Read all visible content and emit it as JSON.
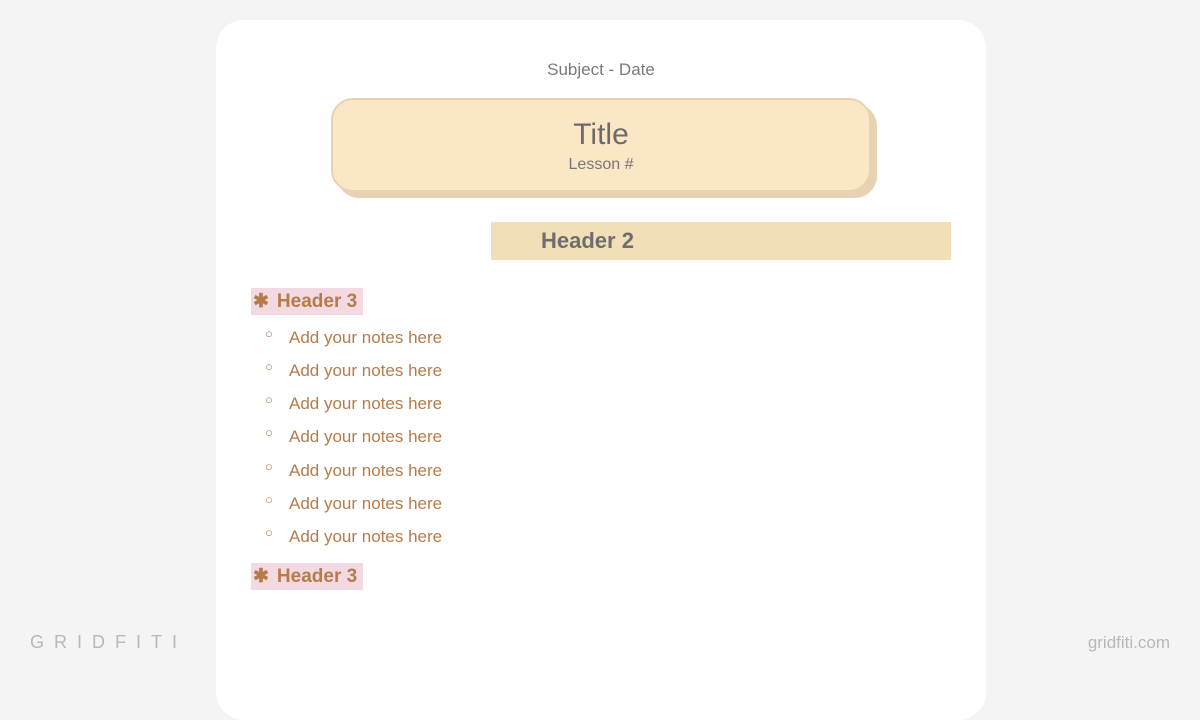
{
  "header": {
    "subject_date": "Subject - Date"
  },
  "titleBox": {
    "title": "Title",
    "lesson": "Lesson #"
  },
  "header2": "Header 2",
  "sections": [
    {
      "label": "Header 3",
      "asterisk": "✱",
      "notes": [
        "Add your notes here",
        "Add your notes here",
        "Add your notes here",
        "Add your notes here",
        "Add your notes here",
        "Add your notes here",
        "Add your notes here"
      ]
    },
    {
      "label": "Header 3",
      "asterisk": "✱",
      "notes": []
    }
  ],
  "watermark": {
    "left": "GRIDFITI",
    "right": "gridfiti.com"
  }
}
